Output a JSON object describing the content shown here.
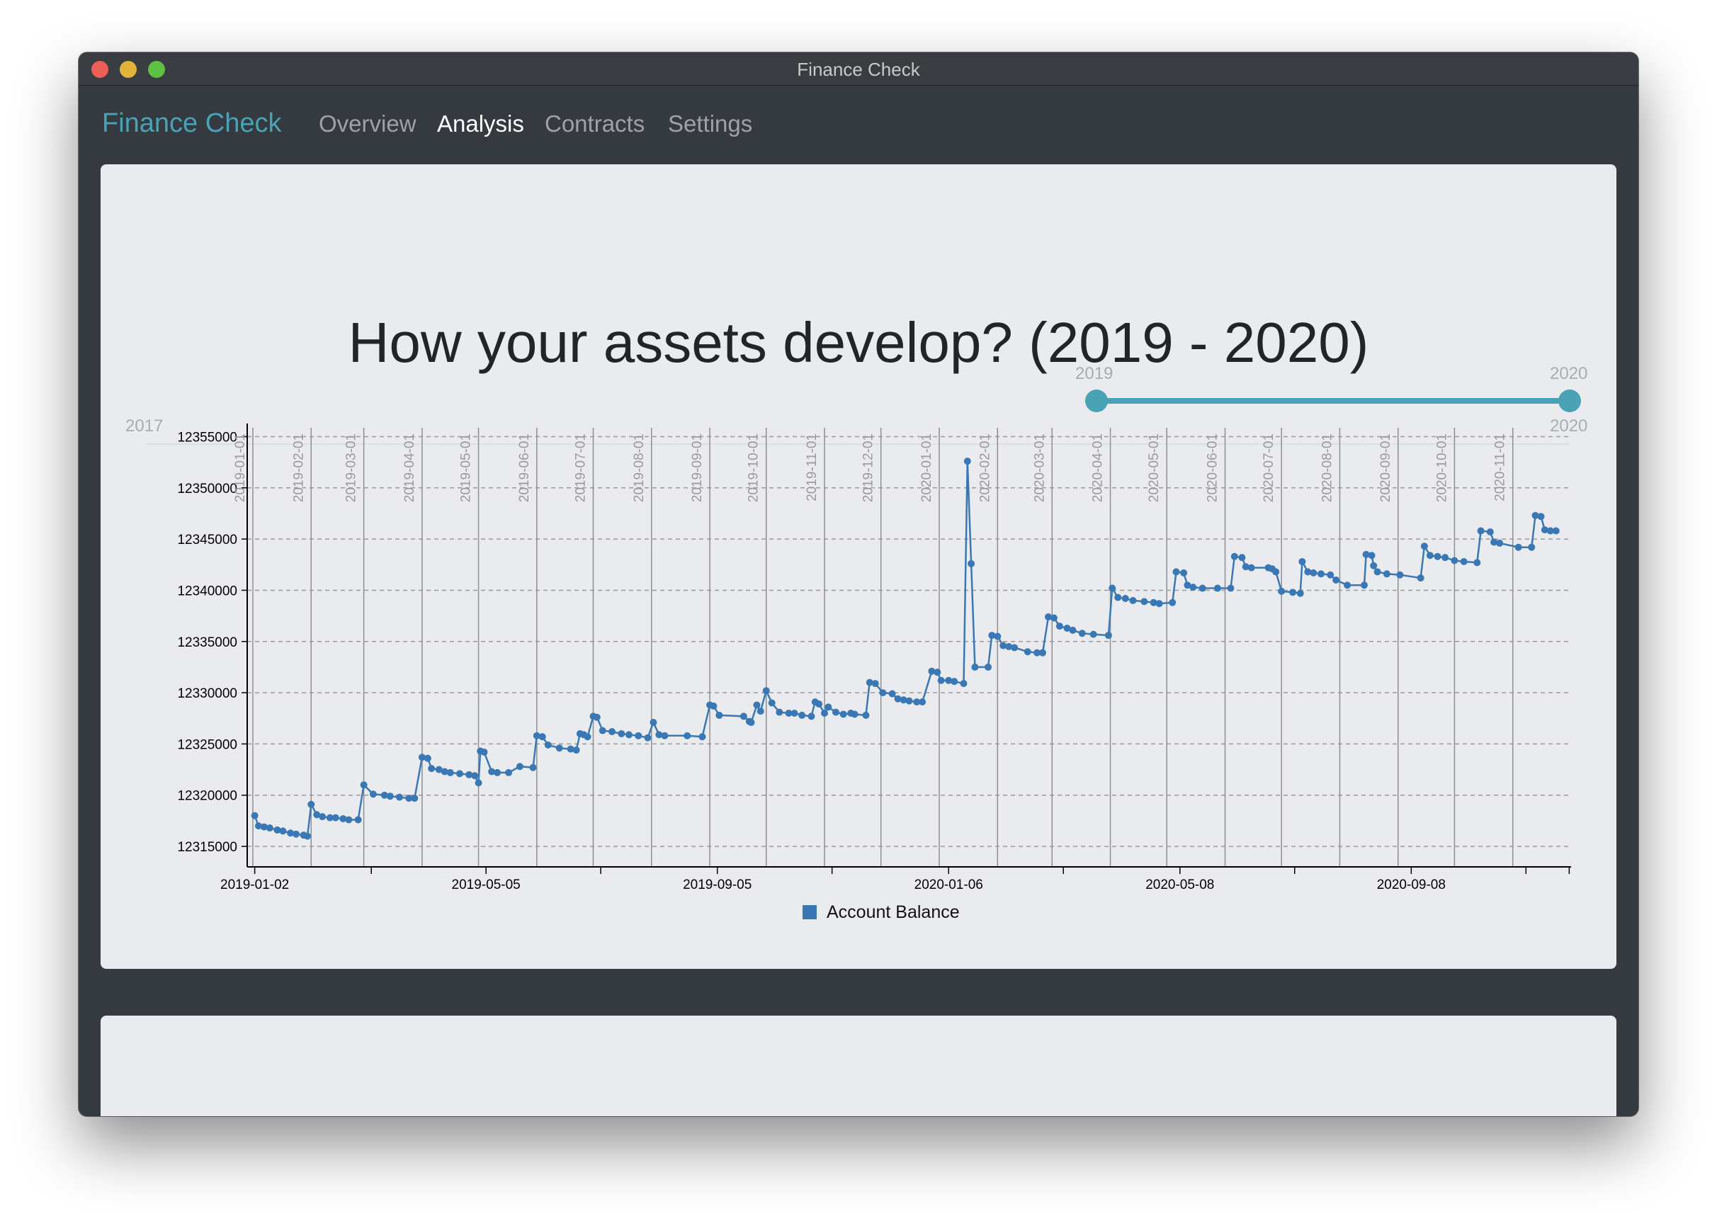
{
  "window": {
    "title": "Finance Check"
  },
  "navbar": {
    "brand": "Finance Check",
    "items": [
      {
        "label": "Overview",
        "active": false
      },
      {
        "label": "Analysis",
        "active": true
      },
      {
        "label": "Contracts",
        "active": false
      },
      {
        "label": "Settings",
        "active": false
      }
    ]
  },
  "analysis": {
    "title": "How your assets develop? (2019 - 2020)",
    "range_slider": {
      "min_label": "2017",
      "max_label": "2020",
      "selected_start_label": "2019",
      "selected_end_label": "2020",
      "start_value": 2019,
      "end_value": 2020,
      "min_value": 2017,
      "max_value": 2020
    }
  },
  "colors": {
    "accent": "#4aa3b5",
    "navbar_bg": "#343a40",
    "card_bg": "#e9ebee",
    "series": "#3a78b5"
  },
  "chart_data": {
    "type": "line",
    "x_type": "date",
    "title": "",
    "xlabel": "",
    "ylabel": "",
    "ylim": [
      12313000,
      12356000
    ],
    "xlim": [
      "2018-12-29",
      "2020-12-02"
    ],
    "yticks": [
      12315000,
      12320000,
      12325000,
      12330000,
      12335000,
      12340000,
      12345000,
      12350000,
      12355000
    ],
    "xtick_labels": [
      "2019-01-02",
      "2019-05-05",
      "2019-09-05",
      "2020-01-06",
      "2020-05-08",
      "2020-09-08"
    ],
    "month_markers": [
      "2019-01-01",
      "2019-02-01",
      "2019-03-01",
      "2019-04-01",
      "2019-05-01",
      "2019-06-01",
      "2019-07-01",
      "2019-08-01",
      "2019-09-01",
      "2019-10-01",
      "2019-11-01",
      "2019-12-01",
      "2020-01-01",
      "2020-02-01",
      "2020-03-01",
      "2020-04-01",
      "2020-05-01",
      "2020-06-01",
      "2020-07-01",
      "2020-08-01",
      "2020-09-01",
      "2020-10-01",
      "2020-11-01"
    ],
    "month_marker_labels": [
      "2019-01-01",
      "2019-02-01",
      "2019-03-01",
      "2019-04-01",
      "2019-05-01",
      "2019-06-01",
      "2019-07-01",
      "2019-08-01",
      "2019-09-01",
      "2019-10-01",
      "2019-11-01",
      "2019-12-01",
      "2020-01-01",
      "2020-02-01",
      "2020-03-01",
      "2020-04-01",
      "2020-05-01",
      "2020-06-01",
      "2020-07-01",
      "2020-08-01",
      "2020-09-01",
      "2020-10-01",
      "2020-11-01"
    ],
    "grid": true,
    "legend": "bottom",
    "series": [
      {
        "name": "Account Balance",
        "points": [
          [
            "2019-01-02",
            12318000
          ],
          [
            "2019-01-04",
            12317000
          ],
          [
            "2019-01-07",
            12316900
          ],
          [
            "2019-01-10",
            12316800
          ],
          [
            "2019-01-14",
            12316600
          ],
          [
            "2019-01-17",
            12316500
          ],
          [
            "2019-01-21",
            12316300
          ],
          [
            "2019-01-24",
            12316200
          ],
          [
            "2019-01-28",
            12316100
          ],
          [
            "2019-01-30",
            12316000
          ],
          [
            "2019-02-01",
            12319100
          ],
          [
            "2019-02-04",
            12318100
          ],
          [
            "2019-02-07",
            12317900
          ],
          [
            "2019-02-11",
            12317800
          ],
          [
            "2019-02-14",
            12317800
          ],
          [
            "2019-02-18",
            12317700
          ],
          [
            "2019-02-21",
            12317600
          ],
          [
            "2019-02-26",
            12317600
          ],
          [
            "2019-03-01",
            12321000
          ],
          [
            "2019-03-06",
            12320100
          ],
          [
            "2019-03-12",
            12320000
          ],
          [
            "2019-03-15",
            12319900
          ],
          [
            "2019-03-20",
            12319800
          ],
          [
            "2019-03-25",
            12319700
          ],
          [
            "2019-03-28",
            12319700
          ],
          [
            "2019-04-01",
            12323700
          ],
          [
            "2019-04-04",
            12323600
          ],
          [
            "2019-04-06",
            12322600
          ],
          [
            "2019-04-10",
            12322500
          ],
          [
            "2019-04-13",
            12322300
          ],
          [
            "2019-04-16",
            12322200
          ],
          [
            "2019-04-21",
            12322100
          ],
          [
            "2019-04-26",
            12322000
          ],
          [
            "2019-04-29",
            12321900
          ],
          [
            "2019-05-01",
            12321200
          ],
          [
            "2019-05-02",
            12324300
          ],
          [
            "2019-05-04",
            12324200
          ],
          [
            "2019-05-08",
            12322300
          ],
          [
            "2019-05-11",
            12322200
          ],
          [
            "2019-05-17",
            12322200
          ],
          [
            "2019-05-23",
            12322800
          ],
          [
            "2019-05-30",
            12322700
          ],
          [
            "2019-06-01",
            12325800
          ],
          [
            "2019-06-04",
            12325700
          ],
          [
            "2019-06-07",
            12324900
          ],
          [
            "2019-06-13",
            12324600
          ],
          [
            "2019-06-19",
            12324500
          ],
          [
            "2019-06-22",
            12324400
          ],
          [
            "2019-06-24",
            12326000
          ],
          [
            "2019-06-26",
            12325900
          ],
          [
            "2019-06-28",
            12325700
          ],
          [
            "2019-07-01",
            12327700
          ],
          [
            "2019-07-03",
            12327600
          ],
          [
            "2019-07-06",
            12326300
          ],
          [
            "2019-07-11",
            12326200
          ],
          [
            "2019-07-16",
            12326000
          ],
          [
            "2019-07-20",
            12325900
          ],
          [
            "2019-07-25",
            12325800
          ],
          [
            "2019-07-30",
            12325600
          ],
          [
            "2019-08-02",
            12327100
          ],
          [
            "2019-08-05",
            12325900
          ],
          [
            "2019-08-08",
            12325800
          ],
          [
            "2019-08-20",
            12325800
          ],
          [
            "2019-08-28",
            12325700
          ],
          [
            "2019-09-01",
            12328800
          ],
          [
            "2019-09-03",
            12328700
          ],
          [
            "2019-09-06",
            12327800
          ],
          [
            "2019-09-19",
            12327700
          ],
          [
            "2019-09-22",
            12327200
          ],
          [
            "2019-09-23",
            12327100
          ],
          [
            "2019-09-26",
            12328800
          ],
          [
            "2019-09-28",
            12328200
          ],
          [
            "2019-10-01",
            12330200
          ],
          [
            "2019-10-04",
            12329000
          ],
          [
            "2019-10-08",
            12328100
          ],
          [
            "2019-10-13",
            12328000
          ],
          [
            "2019-10-16",
            12328000
          ],
          [
            "2019-10-20",
            12327800
          ],
          [
            "2019-10-25",
            12327700
          ],
          [
            "2019-10-27",
            12329100
          ],
          [
            "2019-10-29",
            12328900
          ],
          [
            "2019-11-01",
            12328000
          ],
          [
            "2019-11-03",
            12328600
          ],
          [
            "2019-11-07",
            12328100
          ],
          [
            "2019-11-11",
            12327900
          ],
          [
            "2019-11-15",
            12328000
          ],
          [
            "2019-11-17",
            12327900
          ],
          [
            "2019-11-23",
            12327800
          ],
          [
            "2019-11-25",
            12331000
          ],
          [
            "2019-11-28",
            12330900
          ],
          [
            "2019-12-02",
            12330000
          ],
          [
            "2019-12-07",
            12329900
          ],
          [
            "2019-12-10",
            12329400
          ],
          [
            "2019-12-13",
            12329300
          ],
          [
            "2019-12-16",
            12329200
          ],
          [
            "2019-12-20",
            12329100
          ],
          [
            "2019-12-23",
            12329100
          ],
          [
            "2019-12-28",
            12332100
          ],
          [
            "2019-12-31",
            12332000
          ],
          [
            "2020-01-02",
            12331200
          ],
          [
            "2020-01-06",
            12331200
          ],
          [
            "2020-01-09",
            12331100
          ],
          [
            "2020-01-14",
            12330900
          ],
          [
            "2020-01-16",
            12352600
          ],
          [
            "2020-01-18",
            12342600
          ],
          [
            "2020-01-20",
            12332500
          ],
          [
            "2020-01-27",
            12332500
          ],
          [
            "2020-01-29",
            12335600
          ],
          [
            "2020-02-01",
            12335500
          ],
          [
            "2020-02-04",
            12334600
          ],
          [
            "2020-02-07",
            12334500
          ],
          [
            "2020-02-10",
            12334400
          ],
          [
            "2020-02-17",
            12334000
          ],
          [
            "2020-02-22",
            12333900
          ],
          [
            "2020-02-25",
            12333900
          ],
          [
            "2020-02-28",
            12337400
          ],
          [
            "2020-03-02",
            12337300
          ],
          [
            "2020-03-05",
            12336500
          ],
          [
            "2020-03-09",
            12336300
          ],
          [
            "2020-03-12",
            12336100
          ],
          [
            "2020-03-17",
            12335800
          ],
          [
            "2020-03-23",
            12335700
          ],
          [
            "2020-03-31",
            12335600
          ],
          [
            "2020-04-02",
            12340200
          ],
          [
            "2020-04-05",
            12339300
          ],
          [
            "2020-04-09",
            12339200
          ],
          [
            "2020-04-13",
            12339000
          ],
          [
            "2020-04-19",
            12338900
          ],
          [
            "2020-04-24",
            12338800
          ],
          [
            "2020-04-27",
            12338700
          ],
          [
            "2020-05-04",
            12338800
          ],
          [
            "2020-05-06",
            12341800
          ],
          [
            "2020-05-10",
            12341700
          ],
          [
            "2020-05-12",
            12340500
          ],
          [
            "2020-05-15",
            12340300
          ],
          [
            "2020-05-20",
            12340200
          ],
          [
            "2020-05-28",
            12340200
          ],
          [
            "2020-06-04",
            12340200
          ],
          [
            "2020-06-06",
            12343300
          ],
          [
            "2020-06-10",
            12343200
          ],
          [
            "2020-06-12",
            12342300
          ],
          [
            "2020-06-15",
            12342200
          ],
          [
            "2020-06-24",
            12342200
          ],
          [
            "2020-06-26",
            12342100
          ],
          [
            "2020-06-28",
            12341800
          ],
          [
            "2020-07-01",
            12339900
          ],
          [
            "2020-07-07",
            12339800
          ],
          [
            "2020-07-11",
            12339700
          ],
          [
            "2020-07-12",
            12342800
          ],
          [
            "2020-07-15",
            12341800
          ],
          [
            "2020-07-18",
            12341700
          ],
          [
            "2020-07-22",
            12341600
          ],
          [
            "2020-07-27",
            12341500
          ],
          [
            "2020-07-30",
            12341000
          ],
          [
            "2020-08-05",
            12340500
          ],
          [
            "2020-08-14",
            12340500
          ],
          [
            "2020-08-15",
            12343500
          ],
          [
            "2020-08-18",
            12343400
          ],
          [
            "2020-08-19",
            12342400
          ],
          [
            "2020-08-21",
            12341800
          ],
          [
            "2020-08-26",
            12341600
          ],
          [
            "2020-09-02",
            12341500
          ],
          [
            "2020-09-13",
            12341200
          ],
          [
            "2020-09-15",
            12344300
          ],
          [
            "2020-09-18",
            12343400
          ],
          [
            "2020-09-22",
            12343300
          ],
          [
            "2020-09-26",
            12343200
          ],
          [
            "2020-10-01",
            12342900
          ],
          [
            "2020-10-06",
            12342800
          ],
          [
            "2020-10-13",
            12342700
          ],
          [
            "2020-10-15",
            12345800
          ],
          [
            "2020-10-20",
            12345700
          ],
          [
            "2020-10-22",
            12344700
          ],
          [
            "2020-10-25",
            12344600
          ],
          [
            "2020-11-04",
            12344200
          ],
          [
            "2020-11-11",
            12344200
          ],
          [
            "2020-11-13",
            12347300
          ],
          [
            "2020-11-16",
            12347200
          ],
          [
            "2020-11-18",
            12345900
          ],
          [
            "2020-11-21",
            12345800
          ],
          [
            "2020-11-24",
            12345800
          ]
        ]
      }
    ]
  }
}
